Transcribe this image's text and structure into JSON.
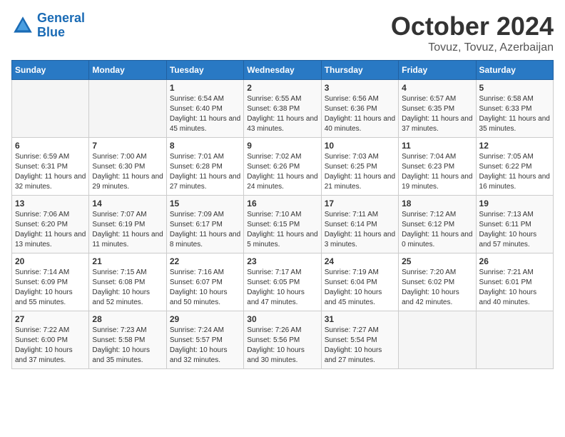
{
  "logo": {
    "line1": "General",
    "line2": "Blue"
  },
  "title": "October 2024",
  "location": "Tovuz, Tovuz, Azerbaijan",
  "days_of_week": [
    "Sunday",
    "Monday",
    "Tuesday",
    "Wednesday",
    "Thursday",
    "Friday",
    "Saturday"
  ],
  "weeks": [
    [
      {
        "day": "",
        "sunrise": "",
        "sunset": "",
        "daylight": ""
      },
      {
        "day": "",
        "sunrise": "",
        "sunset": "",
        "daylight": ""
      },
      {
        "day": "1",
        "sunrise": "Sunrise: 6:54 AM",
        "sunset": "Sunset: 6:40 PM",
        "daylight": "Daylight: 11 hours and 45 minutes."
      },
      {
        "day": "2",
        "sunrise": "Sunrise: 6:55 AM",
        "sunset": "Sunset: 6:38 PM",
        "daylight": "Daylight: 11 hours and 43 minutes."
      },
      {
        "day": "3",
        "sunrise": "Sunrise: 6:56 AM",
        "sunset": "Sunset: 6:36 PM",
        "daylight": "Daylight: 11 hours and 40 minutes."
      },
      {
        "day": "4",
        "sunrise": "Sunrise: 6:57 AM",
        "sunset": "Sunset: 6:35 PM",
        "daylight": "Daylight: 11 hours and 37 minutes."
      },
      {
        "day": "5",
        "sunrise": "Sunrise: 6:58 AM",
        "sunset": "Sunset: 6:33 PM",
        "daylight": "Daylight: 11 hours and 35 minutes."
      }
    ],
    [
      {
        "day": "6",
        "sunrise": "Sunrise: 6:59 AM",
        "sunset": "Sunset: 6:31 PM",
        "daylight": "Daylight: 11 hours and 32 minutes."
      },
      {
        "day": "7",
        "sunrise": "Sunrise: 7:00 AM",
        "sunset": "Sunset: 6:30 PM",
        "daylight": "Daylight: 11 hours and 29 minutes."
      },
      {
        "day": "8",
        "sunrise": "Sunrise: 7:01 AM",
        "sunset": "Sunset: 6:28 PM",
        "daylight": "Daylight: 11 hours and 27 minutes."
      },
      {
        "day": "9",
        "sunrise": "Sunrise: 7:02 AM",
        "sunset": "Sunset: 6:26 PM",
        "daylight": "Daylight: 11 hours and 24 minutes."
      },
      {
        "day": "10",
        "sunrise": "Sunrise: 7:03 AM",
        "sunset": "Sunset: 6:25 PM",
        "daylight": "Daylight: 11 hours and 21 minutes."
      },
      {
        "day": "11",
        "sunrise": "Sunrise: 7:04 AM",
        "sunset": "Sunset: 6:23 PM",
        "daylight": "Daylight: 11 hours and 19 minutes."
      },
      {
        "day": "12",
        "sunrise": "Sunrise: 7:05 AM",
        "sunset": "Sunset: 6:22 PM",
        "daylight": "Daylight: 11 hours and 16 minutes."
      }
    ],
    [
      {
        "day": "13",
        "sunrise": "Sunrise: 7:06 AM",
        "sunset": "Sunset: 6:20 PM",
        "daylight": "Daylight: 11 hours and 13 minutes."
      },
      {
        "day": "14",
        "sunrise": "Sunrise: 7:07 AM",
        "sunset": "Sunset: 6:19 PM",
        "daylight": "Daylight: 11 hours and 11 minutes."
      },
      {
        "day": "15",
        "sunrise": "Sunrise: 7:09 AM",
        "sunset": "Sunset: 6:17 PM",
        "daylight": "Daylight: 11 hours and 8 minutes."
      },
      {
        "day": "16",
        "sunrise": "Sunrise: 7:10 AM",
        "sunset": "Sunset: 6:15 PM",
        "daylight": "Daylight: 11 hours and 5 minutes."
      },
      {
        "day": "17",
        "sunrise": "Sunrise: 7:11 AM",
        "sunset": "Sunset: 6:14 PM",
        "daylight": "Daylight: 11 hours and 3 minutes."
      },
      {
        "day": "18",
        "sunrise": "Sunrise: 7:12 AM",
        "sunset": "Sunset: 6:12 PM",
        "daylight": "Daylight: 11 hours and 0 minutes."
      },
      {
        "day": "19",
        "sunrise": "Sunrise: 7:13 AM",
        "sunset": "Sunset: 6:11 PM",
        "daylight": "Daylight: 10 hours and 57 minutes."
      }
    ],
    [
      {
        "day": "20",
        "sunrise": "Sunrise: 7:14 AM",
        "sunset": "Sunset: 6:09 PM",
        "daylight": "Daylight: 10 hours and 55 minutes."
      },
      {
        "day": "21",
        "sunrise": "Sunrise: 7:15 AM",
        "sunset": "Sunset: 6:08 PM",
        "daylight": "Daylight: 10 hours and 52 minutes."
      },
      {
        "day": "22",
        "sunrise": "Sunrise: 7:16 AM",
        "sunset": "Sunset: 6:07 PM",
        "daylight": "Daylight: 10 hours and 50 minutes."
      },
      {
        "day": "23",
        "sunrise": "Sunrise: 7:17 AM",
        "sunset": "Sunset: 6:05 PM",
        "daylight": "Daylight: 10 hours and 47 minutes."
      },
      {
        "day": "24",
        "sunrise": "Sunrise: 7:19 AM",
        "sunset": "Sunset: 6:04 PM",
        "daylight": "Daylight: 10 hours and 45 minutes."
      },
      {
        "day": "25",
        "sunrise": "Sunrise: 7:20 AM",
        "sunset": "Sunset: 6:02 PM",
        "daylight": "Daylight: 10 hours and 42 minutes."
      },
      {
        "day": "26",
        "sunrise": "Sunrise: 7:21 AM",
        "sunset": "Sunset: 6:01 PM",
        "daylight": "Daylight: 10 hours and 40 minutes."
      }
    ],
    [
      {
        "day": "27",
        "sunrise": "Sunrise: 7:22 AM",
        "sunset": "Sunset: 6:00 PM",
        "daylight": "Daylight: 10 hours and 37 minutes."
      },
      {
        "day": "28",
        "sunrise": "Sunrise: 7:23 AM",
        "sunset": "Sunset: 5:58 PM",
        "daylight": "Daylight: 10 hours and 35 minutes."
      },
      {
        "day": "29",
        "sunrise": "Sunrise: 7:24 AM",
        "sunset": "Sunset: 5:57 PM",
        "daylight": "Daylight: 10 hours and 32 minutes."
      },
      {
        "day": "30",
        "sunrise": "Sunrise: 7:26 AM",
        "sunset": "Sunset: 5:56 PM",
        "daylight": "Daylight: 10 hours and 30 minutes."
      },
      {
        "day": "31",
        "sunrise": "Sunrise: 7:27 AM",
        "sunset": "Sunset: 5:54 PM",
        "daylight": "Daylight: 10 hours and 27 minutes."
      },
      {
        "day": "",
        "sunrise": "",
        "sunset": "",
        "daylight": ""
      },
      {
        "day": "",
        "sunrise": "",
        "sunset": "",
        "daylight": ""
      }
    ]
  ]
}
